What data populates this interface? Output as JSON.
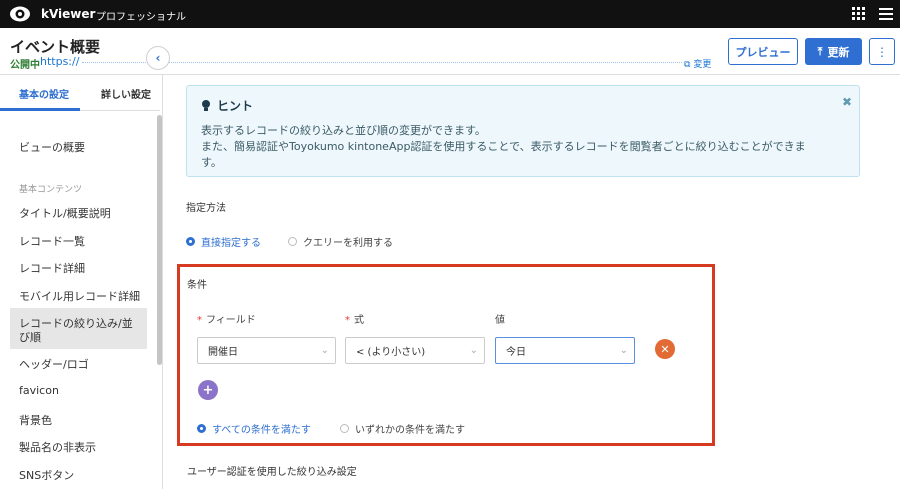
{
  "app": {
    "brand": "kViewer",
    "edition": "プロフェッショナル"
  },
  "header": {
    "title": "イベント概要",
    "status": "公開中",
    "url": "https://",
    "change": "変更",
    "preview": "プレビュー",
    "update": "更新",
    "more": "⋮"
  },
  "sidebar": {
    "tabs": [
      "基本の設定",
      "詳しい設定"
    ],
    "overview": "ビューの概要",
    "section": "基本コンテンツ",
    "items": [
      "タイトル/概要説明",
      "レコード一覧",
      "レコード詳細",
      "モバイル用レコード詳細",
      "レコードの絞り込み/並",
      "び順",
      "ヘッダー/ロゴ",
      "favicon",
      "背景色",
      "製品名の非表示",
      "SNSボタン"
    ]
  },
  "hint": {
    "title": "ヒント",
    "line1": "表示するレコードの絞り込みと並び順の変更ができます。",
    "line2": "また、簡易認証やToyokumo kintoneApp認証を使用することで、表示するレコードを閲覧者ごとに絞り込むことができま",
    "line3": "す。"
  },
  "method": {
    "label": "指定方法",
    "option_direct": "直接指定する",
    "option_query": "クエリーを利用する",
    "selected": "直接指定する"
  },
  "condition": {
    "label": "条件",
    "field_label": "フィールド",
    "expr_label": "式",
    "value_label": "値",
    "field_value": "開催日",
    "expr_value": "<  (より小さい)",
    "value_value": "今日",
    "match_all": "すべての条件を満たす",
    "match_any": "いずれかの条件を満たす",
    "selected_match": "すべての条件を満たす"
  },
  "auth": {
    "label": "ユーザー認証を使用した絞り込み設定"
  },
  "icons": {
    "logo": "eye-logo-icon",
    "grid": "grid-icon",
    "menu": "hamburger-menu-icon",
    "hint": "lightbulb-icon",
    "close": "close-icon",
    "collapse": "chevron-left-icon",
    "add": "plus-icon",
    "remove": "remove-icon"
  },
  "colors": {
    "accent": "#2f6fd1",
    "highlight": "#d63b22",
    "remove": "#e26b35",
    "add": "#8b73c9"
  }
}
